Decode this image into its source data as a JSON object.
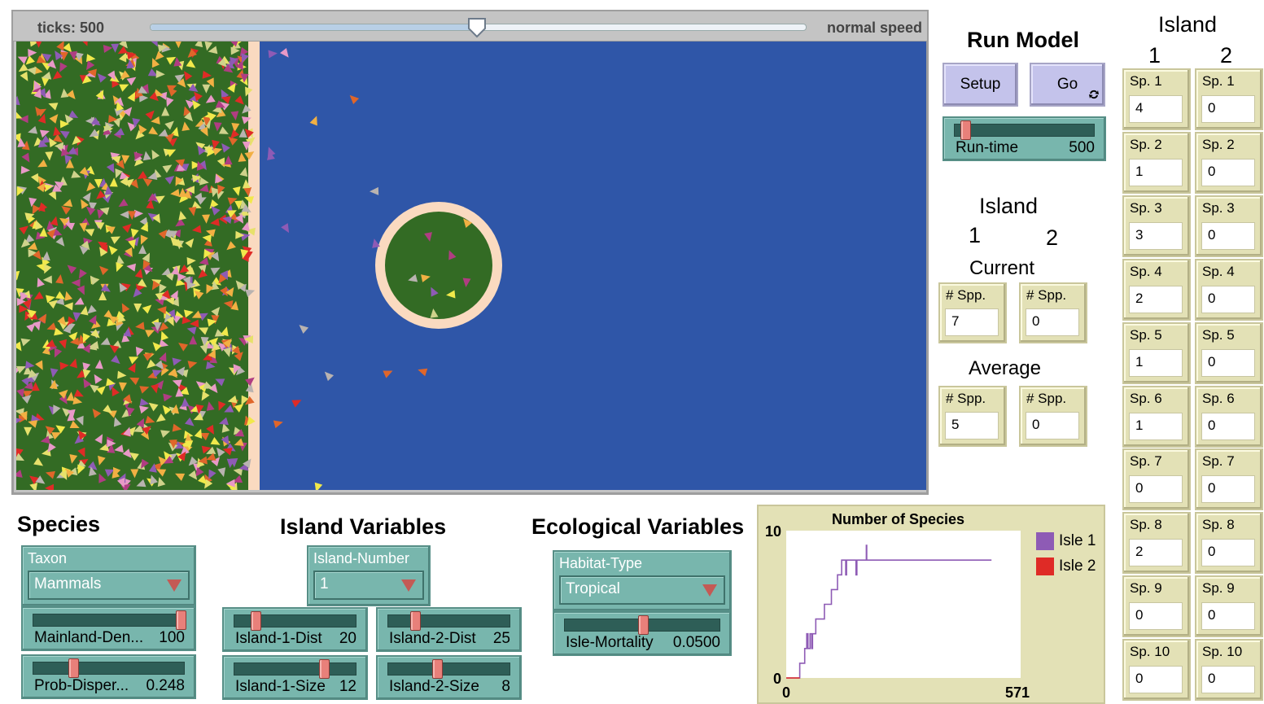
{
  "speed_bar": {
    "ticks_label": "ticks: 500",
    "speed_label": "normal speed",
    "speed_level": 0.495
  },
  "run_model": {
    "heading": "Run Model",
    "setup_label": "Setup",
    "go_label": "Go",
    "runtime": {
      "label": "Run-time",
      "value": "500",
      "level": 0.05
    }
  },
  "island_summary": {
    "heading": "Island",
    "col1": "1",
    "col2": "2",
    "current_label": "Current",
    "average_label": "Average",
    "current": [
      {
        "label": "# Spp.",
        "value": "7"
      },
      {
        "label": "# Spp.",
        "value": "0"
      }
    ],
    "average": [
      {
        "label": "# Spp.",
        "value": "5"
      },
      {
        "label": "# Spp.",
        "value": "0"
      }
    ]
  },
  "species_panel": {
    "heading": "Island",
    "col1": "1",
    "col2": "2",
    "island1": [
      {
        "label": "Sp. 1",
        "value": "4"
      },
      {
        "label": "Sp. 2",
        "value": "1"
      },
      {
        "label": "Sp. 3",
        "value": "3"
      },
      {
        "label": "Sp. 4",
        "value": "2"
      },
      {
        "label": "Sp. 5",
        "value": "1"
      },
      {
        "label": "Sp. 6",
        "value": "1"
      },
      {
        "label": "Sp. 7",
        "value": "0"
      },
      {
        "label": "Sp. 8",
        "value": "2"
      },
      {
        "label": "Sp. 9",
        "value": "0"
      },
      {
        "label": "Sp. 10",
        "value": "0"
      }
    ],
    "island2": [
      {
        "label": "Sp. 1",
        "value": "0"
      },
      {
        "label": "Sp. 2",
        "value": "0"
      },
      {
        "label": "Sp. 3",
        "value": "0"
      },
      {
        "label": "Sp. 4",
        "value": "0"
      },
      {
        "label": "Sp. 5",
        "value": "0"
      },
      {
        "label": "Sp. 6",
        "value": "0"
      },
      {
        "label": "Sp. 7",
        "value": "0"
      },
      {
        "label": "Sp. 8",
        "value": "0"
      },
      {
        "label": "Sp. 9",
        "value": "0"
      },
      {
        "label": "Sp. 10",
        "value": "0"
      }
    ]
  },
  "species_section": {
    "heading": "Species",
    "taxon": {
      "label": "Taxon",
      "value": "Mammals"
    },
    "mainland_density": {
      "label": "Mainland-Den...",
      "value": "100",
      "level": 1.0
    },
    "prob_dispersal": {
      "label": "Prob-Disper...",
      "value": "0.248",
      "level": 0.25
    }
  },
  "island_variables": {
    "heading": "Island Variables",
    "island_number": {
      "label": "Island-Number",
      "value": "1"
    },
    "island1_dist": {
      "label": "Island-1-Dist",
      "value": "20",
      "level": 0.15
    },
    "island2_dist": {
      "label": "Island-2-Dist",
      "value": "25",
      "level": 0.2
    },
    "island1_size": {
      "label": "Island-1-Size",
      "value": "12",
      "level": 0.75
    },
    "island2_size": {
      "label": "Island-2-Size",
      "value": "8",
      "level": 0.39
    }
  },
  "ecological_variables": {
    "heading": "Ecological Variables",
    "habitat_type": {
      "label": "Habitat-Type",
      "value": "Tropical"
    },
    "isle_mortality": {
      "label": "Isle-Mortality",
      "value": "0.0500",
      "level": 0.5
    }
  },
  "colors": {
    "mainland": "#336b24",
    "ocean": "#2f56a8",
    "shore": "#fadac0",
    "isle1": "#8e5bb5",
    "isle2": "#df2b26"
  },
  "chart_data": {
    "type": "line",
    "title": "Number of Species",
    "xlim": [
      0,
      571
    ],
    "ylim": [
      0,
      10
    ],
    "x_ticks": [
      "0",
      "571"
    ],
    "y_ticks": [
      "0",
      "10"
    ],
    "legend": [
      "Isle 1",
      "Isle 2"
    ],
    "series": [
      {
        "name": "Isle 1",
        "color": "#8e5bb5",
        "points": [
          [
            0,
            0
          ],
          [
            33,
            0
          ],
          [
            33,
            1
          ],
          [
            45,
            1
          ],
          [
            45,
            2
          ],
          [
            50,
            2
          ],
          [
            50,
            3
          ],
          [
            53,
            3
          ],
          [
            53,
            2
          ],
          [
            58,
            2
          ],
          [
            58,
            3
          ],
          [
            62,
            3
          ],
          [
            62,
            2
          ],
          [
            64,
            2
          ],
          [
            64,
            3
          ],
          [
            72,
            3
          ],
          [
            72,
            4
          ],
          [
            93,
            4
          ],
          [
            93,
            5
          ],
          [
            110,
            5
          ],
          [
            110,
            6
          ],
          [
            125,
            6
          ],
          [
            125,
            7
          ],
          [
            135,
            7
          ],
          [
            135,
            8
          ],
          [
            145,
            8
          ],
          [
            145,
            7
          ],
          [
            147,
            7
          ],
          [
            147,
            8
          ],
          [
            170,
            8
          ],
          [
            170,
            7
          ],
          [
            172,
            7
          ],
          [
            172,
            8
          ],
          [
            195,
            8
          ],
          [
            195,
            9
          ],
          [
            196,
            9
          ],
          [
            196,
            8
          ],
          [
            500,
            8
          ]
        ]
      },
      {
        "name": "Isle 2",
        "color": "#df2b26",
        "points": [
          [
            0,
            0
          ],
          [
            33,
            0
          ]
        ]
      }
    ]
  }
}
